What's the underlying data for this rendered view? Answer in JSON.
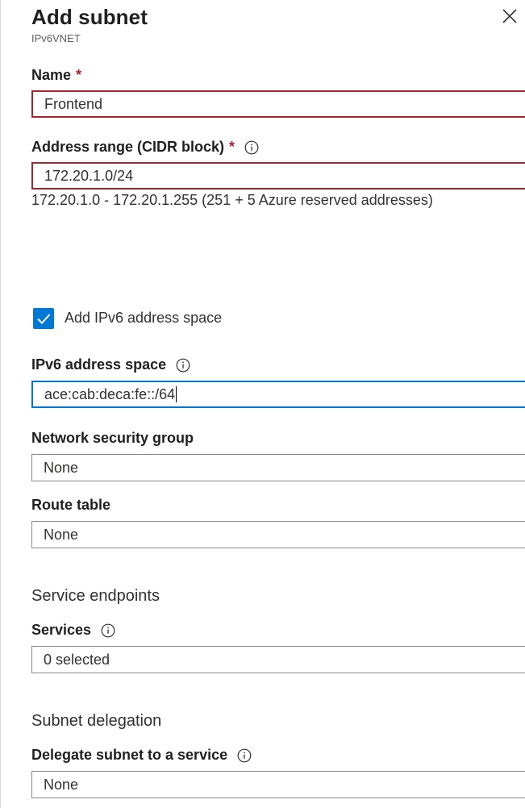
{
  "header": {
    "title": "Add subnet",
    "subtitle": "IPv6VNET"
  },
  "name_field": {
    "label": "Name",
    "required_mark": "*",
    "value": "Frontend"
  },
  "address_range": {
    "label": "Address range (CIDR block)",
    "required_mark": "*",
    "value": "172.20.1.0/24",
    "helper": "172.20.1.0 - 172.20.1.255 (251 + 5 Azure reserved addresses)"
  },
  "ipv6_checkbox": {
    "label": "Add IPv6 address space",
    "checked": true
  },
  "ipv6_address": {
    "label": "IPv6 address space",
    "value": "ace:cab:deca:fe::/64"
  },
  "nsg": {
    "label": "Network security group",
    "value": "None"
  },
  "route_table": {
    "label": "Route table",
    "value": "None"
  },
  "service_endpoints": {
    "heading": "Service endpoints",
    "services_label": "Services",
    "services_value": "0 selected"
  },
  "subnet_delegation": {
    "heading": "Subnet delegation",
    "delegate_label": "Delegate subnet to a service",
    "delegate_value": "None"
  },
  "colors": {
    "accent": "#0078d4",
    "error": "#a4262c",
    "text": "#323130",
    "border": "#8a8886"
  },
  "icons": {
    "close": "close-icon",
    "info": "info-icon",
    "check": "checkmark-icon"
  }
}
